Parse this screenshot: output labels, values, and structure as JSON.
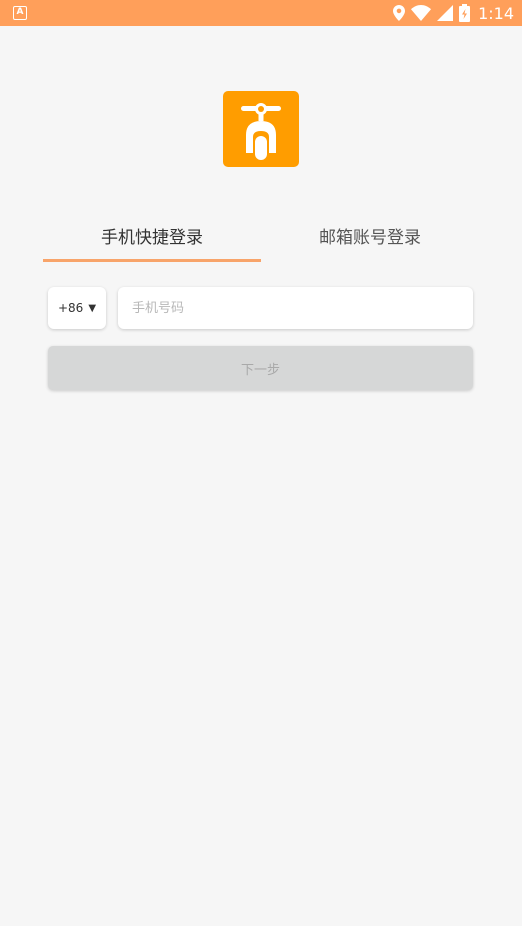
{
  "status_bar": {
    "app_icon_letter": "A",
    "icons": [
      "location-icon",
      "wifi-icon",
      "signal-icon",
      "battery-icon"
    ],
    "time": "1:14",
    "background": "#ff9f5a"
  },
  "logo": {
    "icon": "scooter-icon",
    "background": "#ff9d00"
  },
  "tabs": [
    {
      "label": "手机快捷登录",
      "active": true
    },
    {
      "label": "邮箱账号登录",
      "active": false
    }
  ],
  "accent_color": "#f8a46a",
  "phone_login": {
    "country_code": "+86",
    "country_caret": "▼",
    "phone_placeholder": "手机号码",
    "phone_value": ""
  },
  "next_button": {
    "label": "下一步",
    "enabled": false
  }
}
